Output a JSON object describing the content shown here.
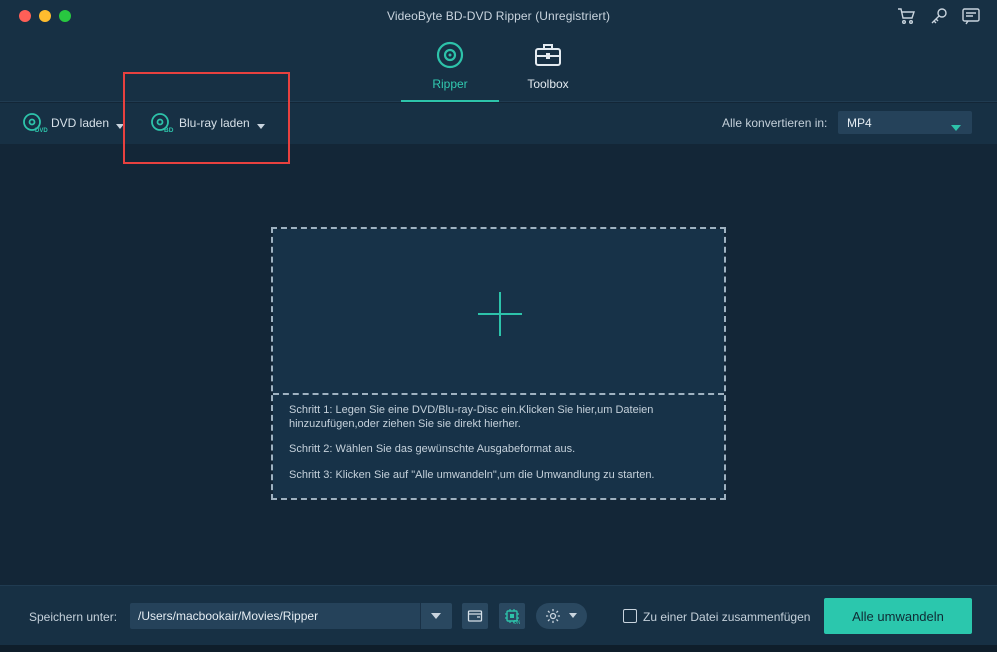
{
  "window": {
    "title": "VideoByte BD-DVD Ripper (Unregistriert)"
  },
  "titlebar_icons": [
    "cart-icon",
    "key-icon",
    "message-icon"
  ],
  "tabs": [
    {
      "label": "Ripper",
      "icon": "disc-icon",
      "active": true
    },
    {
      "label": "Toolbox",
      "icon": "toolbox-icon",
      "active": false
    }
  ],
  "toolbar": {
    "dvd_label": "DVD laden",
    "bluray_label": "Blu-ray laden",
    "convert_all_label": "Alle konvertieren in:",
    "format_value": "MP4"
  },
  "dropzone": {
    "step1": "Schritt 1: Legen Sie eine DVD/Blu-ray-Disc ein.Klicken Sie hier,um Dateien hinzuzufügen,oder ziehen Sie sie direkt hierher.",
    "step2": "Schritt 2: Wählen Sie das gewünschte Ausgabeformat aus.",
    "step3": "Schritt 3: Klicken Sie auf \"Alle umwandeln\",um die Umwandlung zu starten."
  },
  "footer": {
    "save_label": "Speichern unter:",
    "save_path": "/Users/macbookair/Movies/Ripper",
    "hw_badge": "ON",
    "merge_label": "Zu einer Datei zusammenfügen",
    "convert_button": "Alle umwandeln"
  },
  "colors": {
    "accent": "#2bc7ad",
    "background": "#132637",
    "panel": "#173044",
    "highlight": "#e8413f"
  }
}
